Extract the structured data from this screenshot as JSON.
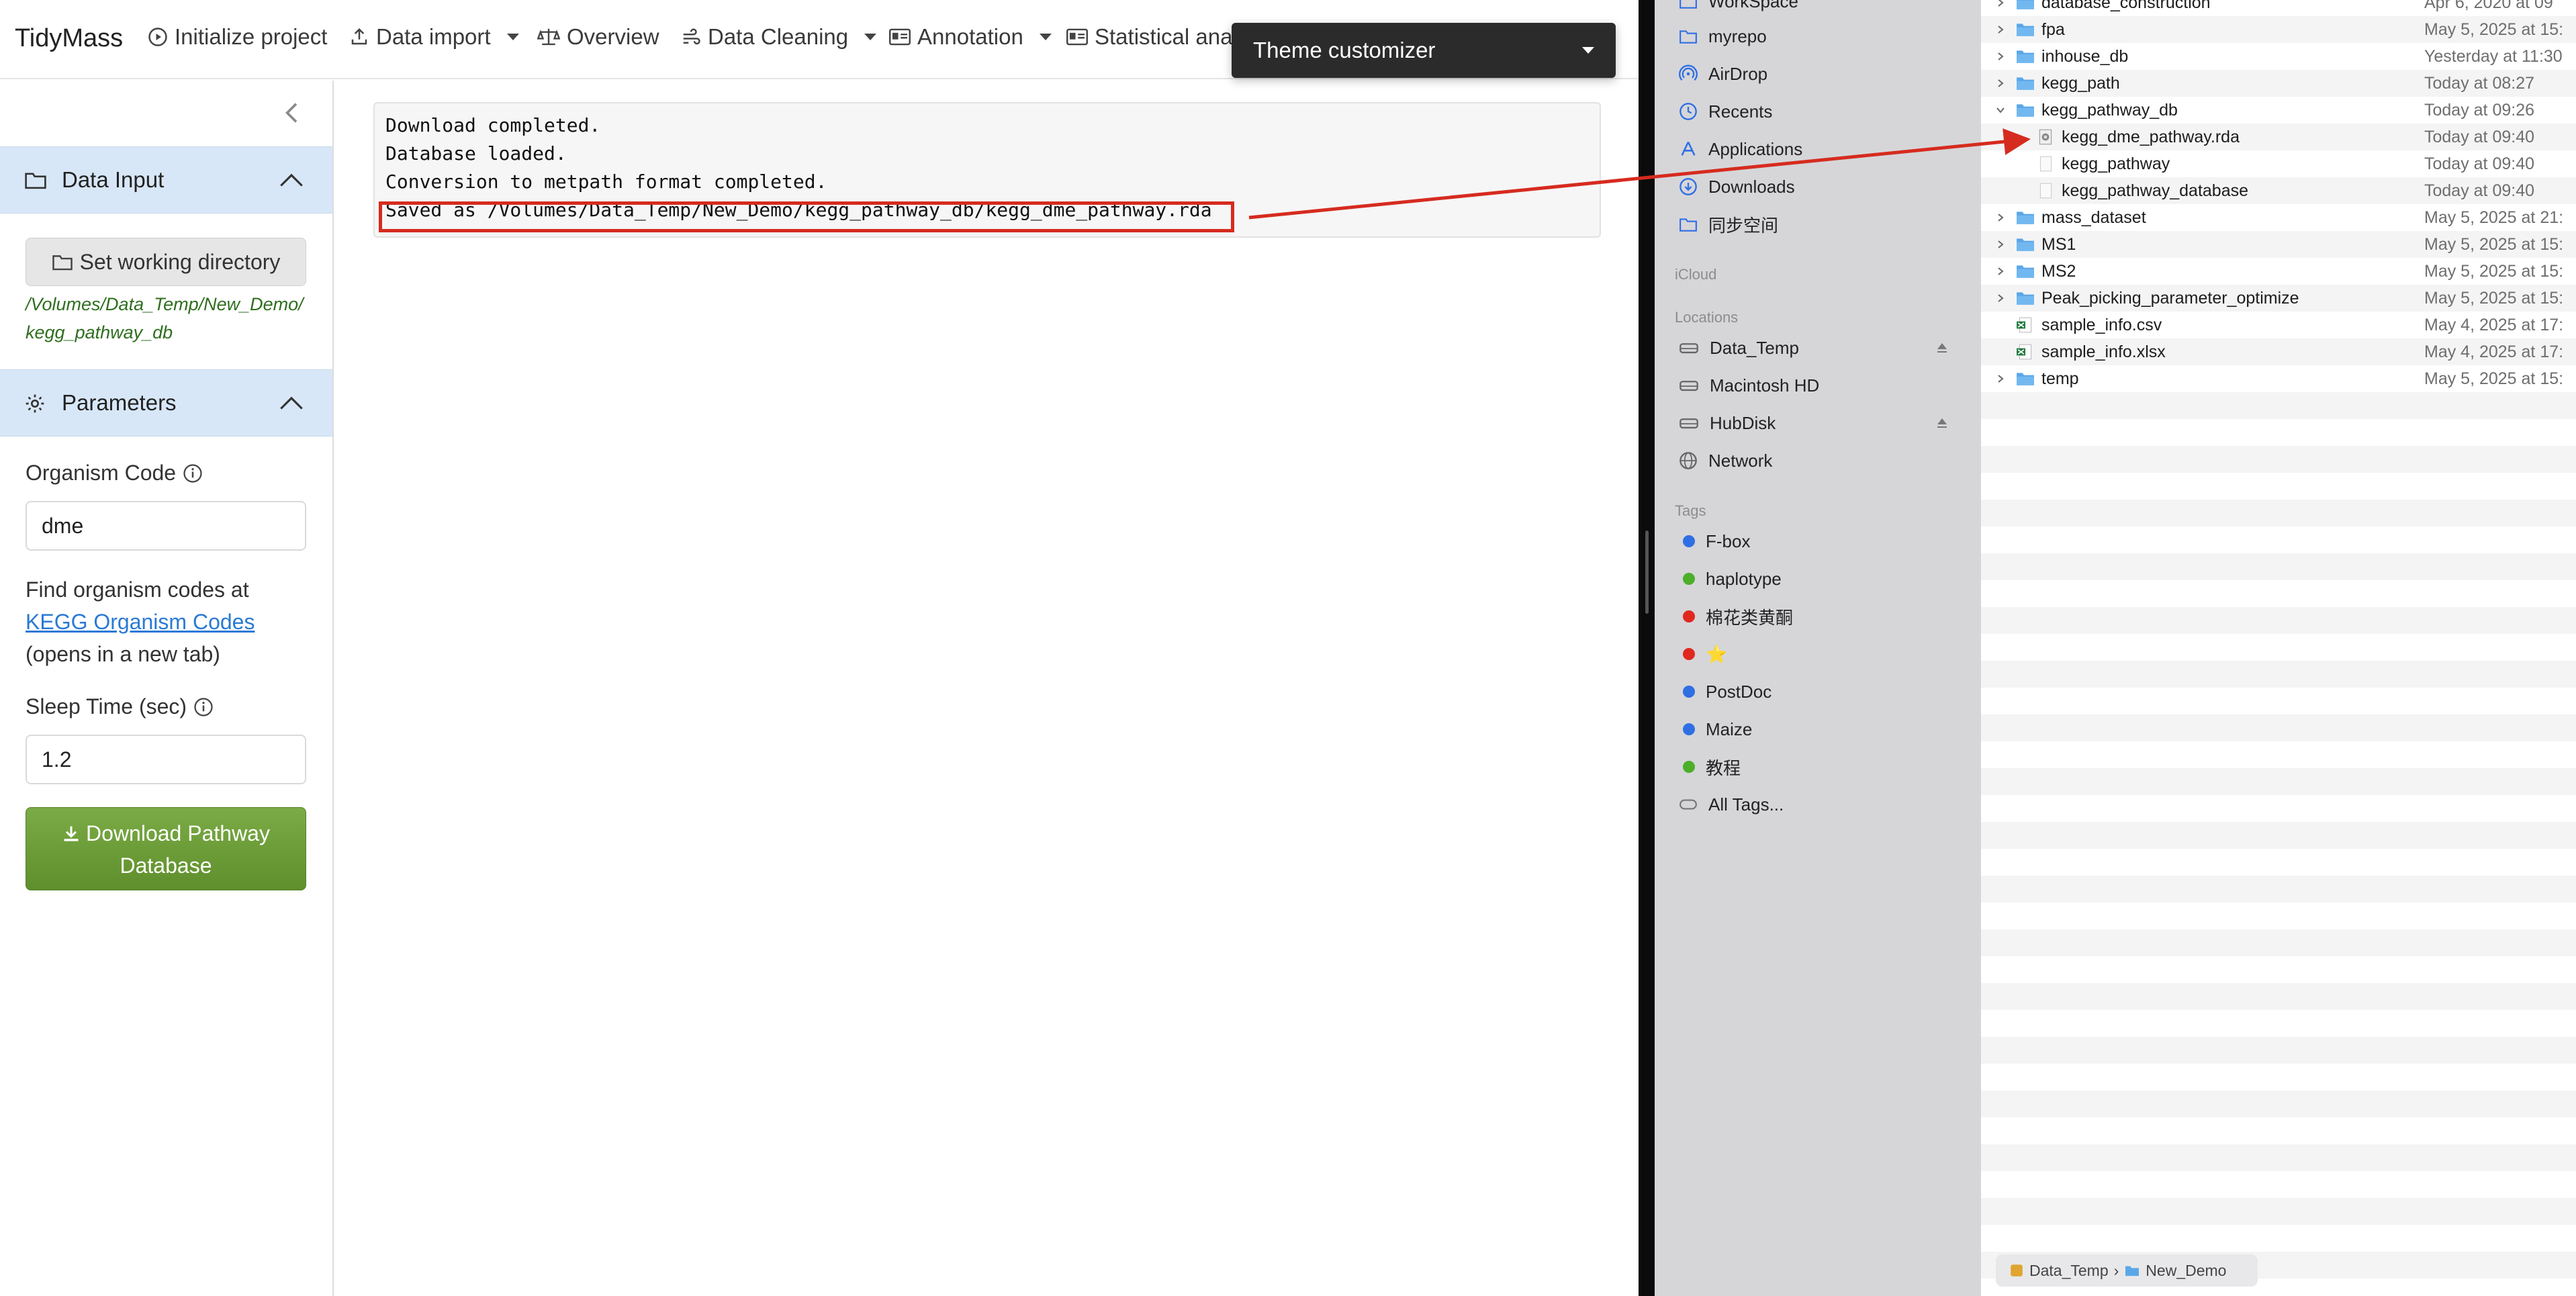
{
  "app": {
    "brand": "TidyMass",
    "nav": [
      {
        "label": "Initialize project",
        "icon": "play-circle-icon"
      },
      {
        "label": "Data import",
        "icon": "upload-icon",
        "dropdown": true
      },
      {
        "label": "Overview",
        "icon": "balance-scale-icon"
      },
      {
        "label": "Data Cleaning",
        "icon": "wind-icon",
        "dropdown": true
      },
      {
        "label": "Annotation",
        "icon": "id-card-icon",
        "dropdown": true
      },
      {
        "label": "Statistical ana",
        "icon": "id-card-icon"
      }
    ],
    "theme_customizer": "Theme customizer"
  },
  "sidebar": {
    "data_input": {
      "title": "Data Input",
      "wd_button": "Set working directory",
      "path": "/Volumes/Data_Temp/New_Demo/kegg_pathway_db"
    },
    "parameters": {
      "title": "Parameters",
      "organism_label": "Organism Code",
      "organism_value": "dme",
      "help_prefix": "Find organism codes at",
      "help_link": "KEGG Organism Codes",
      "help_suffix": "(opens in a new tab)",
      "sleep_label": "Sleep Time (sec)",
      "sleep_value": "1.2",
      "download_button": "Download Pathway Database"
    }
  },
  "log": {
    "lines": [
      "Download completed.",
      "Database loaded.",
      "Conversion to metpath format completed.",
      "Saved as /Volumes/Data_Temp/New_Demo/kegg_pathway_db/kegg_dme_pathway.rda"
    ]
  },
  "finder": {
    "favorites": [
      {
        "label": "WorkSpace",
        "icon": "folder-icon"
      },
      {
        "label": "myrepo",
        "icon": "folder-icon"
      },
      {
        "label": "AirDrop",
        "icon": "airdrop-icon"
      },
      {
        "label": "Recents",
        "icon": "clock-icon"
      },
      {
        "label": "Applications",
        "icon": "applications-icon"
      },
      {
        "label": "Downloads",
        "icon": "download-circle-icon"
      },
      {
        "label": "同步空间",
        "icon": "folder-icon"
      }
    ],
    "icloud_header": "iCloud",
    "locations_header": "Locations",
    "locations": [
      {
        "label": "Data_Temp",
        "eject": true
      },
      {
        "label": "Macintosh HD",
        "eject": false
      },
      {
        "label": "HubDisk",
        "eject": true
      },
      {
        "label": "Network",
        "eject": false
      }
    ],
    "tags_header": "Tags",
    "tags": [
      {
        "label": "F-box",
        "color": "#2f6fe4"
      },
      {
        "label": "haplotype",
        "color": "#4caf2a"
      },
      {
        "label": "棉花类黄酮",
        "color": "#e0281e"
      },
      {
        "label": "⭐",
        "color": "#e0281e"
      },
      {
        "label": "PostDoc",
        "color": "#2f6fe4"
      },
      {
        "label": "Maize",
        "color": "#2f6fe4"
      },
      {
        "label": "教程",
        "color": "#4caf2a"
      }
    ],
    "all_tags": "All Tags...",
    "files": [
      {
        "name": "database_construction",
        "date": "Apr 6, 2020 at 09",
        "type": "folder",
        "level": 0,
        "expanded": false
      },
      {
        "name": "fpa",
        "date": "May 5, 2025 at 15:",
        "type": "folder",
        "level": 0,
        "expanded": false
      },
      {
        "name": "inhouse_db",
        "date": "Yesterday at 11:30",
        "type": "folder",
        "level": 0,
        "expanded": false
      },
      {
        "name": "kegg_path",
        "date": "Today at 08:27",
        "type": "folder",
        "level": 0,
        "expanded": false
      },
      {
        "name": "kegg_pathway_db",
        "date": "Today at 09:26",
        "type": "folder",
        "level": 0,
        "expanded": true
      },
      {
        "name": "kegg_dme_pathway.rda",
        "date": "Today at 09:40",
        "type": "rda",
        "level": 1
      },
      {
        "name": "kegg_pathway",
        "date": "Today at 09:40",
        "type": "file",
        "level": 1
      },
      {
        "name": "kegg_pathway_database",
        "date": "Today at 09:40",
        "type": "file",
        "level": 1
      },
      {
        "name": "mass_dataset",
        "date": "May 5, 2025 at 21:",
        "type": "folder",
        "level": 0,
        "expanded": false
      },
      {
        "name": "MS1",
        "date": "May 5, 2025 at 15:",
        "type": "folder",
        "level": 0,
        "expanded": false
      },
      {
        "name": "MS2",
        "date": "May 5, 2025 at 15:",
        "type": "folder",
        "level": 0,
        "expanded": false
      },
      {
        "name": "Peak_picking_parameter_optimize",
        "date": "May 5, 2025 at 15:",
        "type": "folder",
        "level": 0,
        "expanded": false
      },
      {
        "name": "sample_info.csv",
        "date": "May 4, 2025 at 17:",
        "type": "excel",
        "level": 0
      },
      {
        "name": "sample_info.xlsx",
        "date": "May 4, 2025 at 17:",
        "type": "excel",
        "level": 0
      },
      {
        "name": "temp",
        "date": "May 5, 2025 at 15:",
        "type": "folder",
        "level": 0,
        "expanded": false
      }
    ],
    "path_bar": [
      "Data_Temp",
      "New_Demo"
    ]
  },
  "colors": {
    "accent_blue": "#d8e7f7",
    "download_green": "#6b9b36",
    "highlight_red": "#d62b1f",
    "link_blue": "#2a7ad5",
    "path_green": "#2e6e1e"
  }
}
